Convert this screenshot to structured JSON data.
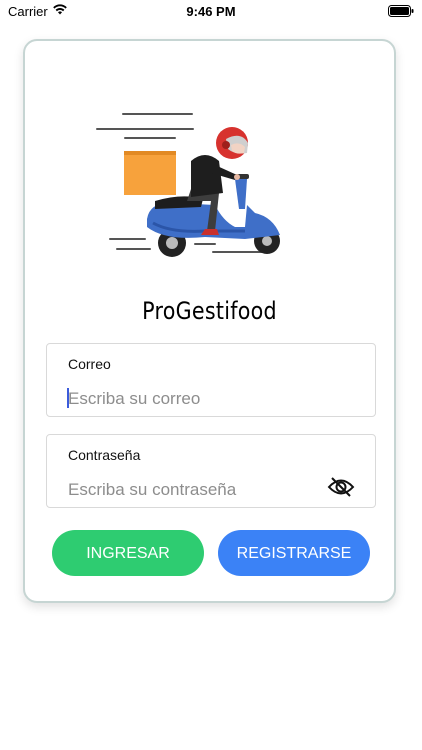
{
  "status_bar": {
    "carrier": "Carrier",
    "time": "9:46 PM",
    "wifi_icon": "wifi-icon",
    "battery_icon": "battery-icon"
  },
  "login": {
    "illustration": "delivery-scooter-illustration",
    "title": "ProGestifood",
    "email": {
      "label": "Correo",
      "placeholder": "Escriba su correo",
      "value": ""
    },
    "password": {
      "label": "Contraseña",
      "placeholder": "Escriba su contraseña",
      "value": "",
      "toggle_icon": "eye-off-icon"
    },
    "buttons": {
      "login_label": "INGRESAR",
      "register_label": "REGISTRARSE"
    }
  },
  "colors": {
    "login_button": "#2ecc71",
    "register_button": "#3b82f6",
    "card_border": "#c6d5d3"
  }
}
